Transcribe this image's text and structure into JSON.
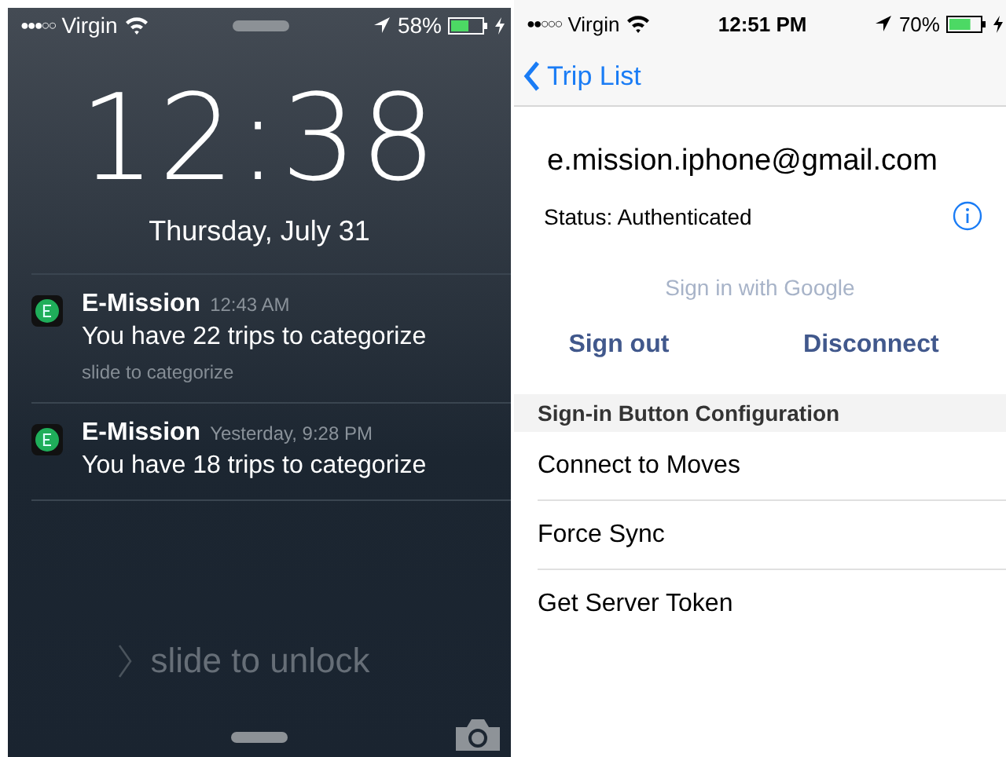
{
  "lock_screen": {
    "status_bar": {
      "signal": "●●●○○",
      "carrier": "Virgin",
      "battery": "58%"
    },
    "time": "12:38",
    "date": "Thursday, July 31",
    "notifications": [
      {
        "app": "E-Mission",
        "time": "12:43 AM",
        "message": "You have 22 trips to categorize",
        "hint": "slide to categorize"
      },
      {
        "app": "E-Mission",
        "time": "Yesterday, 9:28 PM",
        "message": "You have 18 trips to categorize"
      }
    ],
    "unlock": "slide to unlock"
  },
  "settings_screen": {
    "status_bar": {
      "signal": "●●○○○",
      "carrier": "Virgin",
      "time": "12:51 PM",
      "battery": "70%"
    },
    "back": "Trip List",
    "email": "e.mission.iphone@gmail.com",
    "status": "Status: Authenticated",
    "google_button": {
      "label": "Sign in with Google",
      "disabled": true
    },
    "actions": [
      "Sign out",
      "Disconnect"
    ],
    "section": "Sign-in Button Configuration",
    "rows": [
      "Connect to Moves",
      "Force Sync",
      "Get Server Token"
    ]
  }
}
